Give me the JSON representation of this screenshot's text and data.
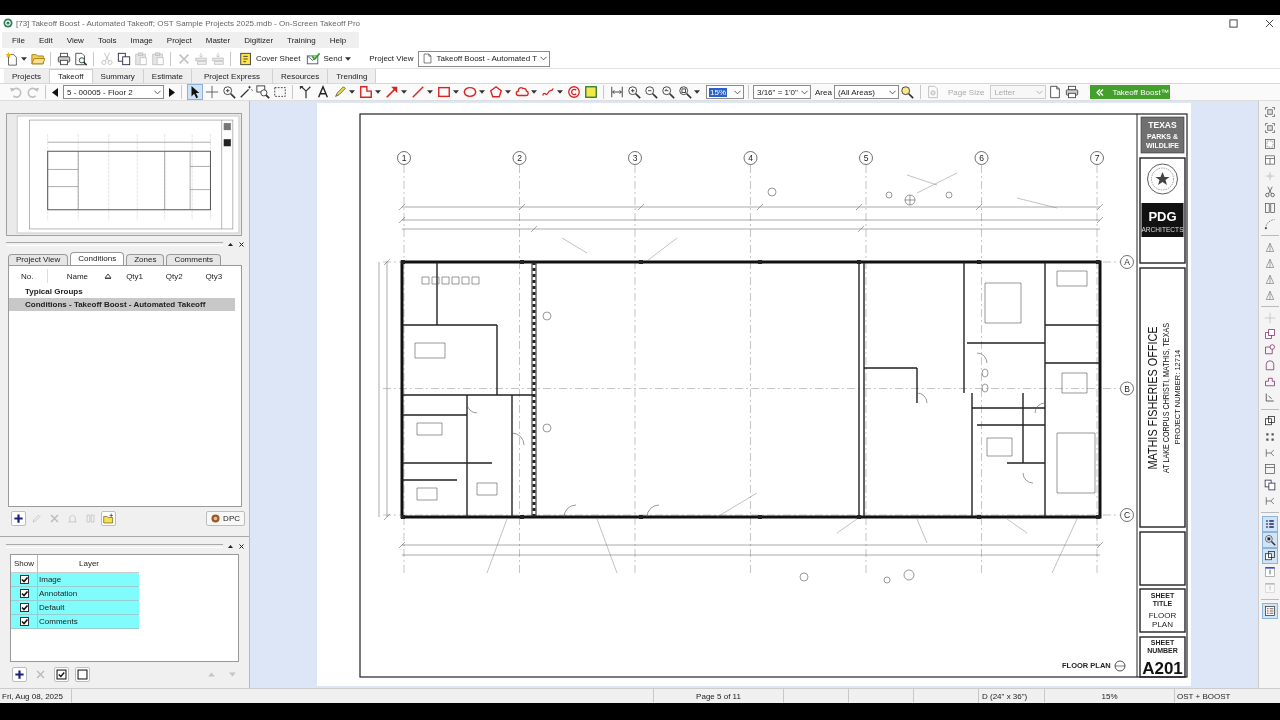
{
  "window": {
    "title": "[73] Takeoff Boost - Automated Takeoff; OST Sample Projects 2025.mdb - On-Screen Takeoff Pro"
  },
  "menu": [
    "File",
    "Edit",
    "View",
    "Tools",
    "Image",
    "Project",
    "Master",
    "Digitizer",
    "Training",
    "Help"
  ],
  "toolbar": {
    "groups": [
      [
        {
          "kind": "new",
          "disabled": false
        },
        {
          "kind": "dropdown",
          "disabled": false
        },
        {
          "kind": "open",
          "disabled": false
        }
      ],
      [
        {
          "kind": "print",
          "disabled": false
        },
        {
          "kind": "preview",
          "disabled": false
        }
      ],
      [
        {
          "kind": "cut",
          "disabled": true
        },
        {
          "kind": "copy",
          "disabled": false
        },
        {
          "kind": "paste",
          "disabled": true
        },
        {
          "kind": "paste",
          "disabled": true
        }
      ],
      [
        {
          "kind": "delete",
          "disabled": true
        },
        {
          "kind": "stack",
          "disabled": true
        },
        {
          "kind": "stack",
          "disabled": true
        }
      ]
    ],
    "cover_sheet": "Cover Sheet",
    "send": "Send",
    "project_view_label": "Project View",
    "project_view_select": "Takeoff Boost - Automated T"
  },
  "tabs": [
    {
      "label": "Projects",
      "selected": false
    },
    {
      "label": "Takeoff",
      "selected": true
    },
    {
      "label": "Summary",
      "selected": false
    },
    {
      "label": "Estimate",
      "selected": false
    },
    {
      "label": "Project Express",
      "selected": false
    },
    {
      "label": "Resources",
      "selected": false
    },
    {
      "label": "Trending",
      "selected": false
    }
  ],
  "page_toolbar": {
    "history": [
      {
        "kind": "undo",
        "disabled": true
      },
      {
        "kind": "redo",
        "disabled": true
      }
    ],
    "page_select": "5 - 00005 - Floor 2",
    "tools": [
      {
        "kind": "pointer",
        "selected": true
      },
      {
        "kind": "crosshair",
        "selected": false
      },
      {
        "kind": "zoom-box",
        "selected": false
      },
      {
        "kind": "wand",
        "selected": false
      },
      {
        "kind": "magnify",
        "selected": false
      },
      {
        "kind": "marquee",
        "selected": false
      }
    ],
    "markup": [
      {
        "kind": "measure"
      },
      {
        "kind": "text"
      },
      {
        "kind": "highlighter"
      },
      {
        "kind": "dropdown"
      },
      {
        "kind": "shape"
      },
      {
        "kind": "dropdown"
      },
      {
        "kind": "arrow"
      },
      {
        "kind": "dropdown"
      },
      {
        "kind": "line"
      },
      {
        "kind": "dropdown"
      },
      {
        "kind": "rect"
      },
      {
        "kind": "dropdown"
      },
      {
        "kind": "ellipse"
      },
      {
        "kind": "dropdown"
      },
      {
        "kind": "polygon"
      },
      {
        "kind": "dropdown"
      },
      {
        "kind": "cloud"
      },
      {
        "kind": "dropdown"
      },
      {
        "kind": "freehand"
      },
      {
        "kind": "dropdown"
      },
      {
        "kind": "stamp"
      },
      {
        "kind": "note"
      }
    ],
    "zoom_tools": [
      {
        "kind": "fit"
      },
      {
        "kind": "zoom-in"
      },
      {
        "kind": "zoom-out"
      },
      {
        "kind": "zoom-prev"
      },
      {
        "kind": "zoom-page"
      },
      {
        "kind": "dropdown"
      }
    ],
    "zoom": "15%",
    "zoom_focused": true,
    "scale": "3/16\" = 1'0\"",
    "area_label": "Area",
    "area_select": "(All Areas)",
    "page_size_label": "Page Size",
    "page_size_select": "Letter",
    "page_size_disabled": true,
    "boost_button": "Takeoff Boost™"
  },
  "conditions_panel": {
    "tabs": [
      {
        "label": "Project View",
        "selected": false
      },
      {
        "label": "Conditions",
        "selected": true
      },
      {
        "label": "Zones",
        "selected": false
      },
      {
        "label": "Comments",
        "selected": false
      }
    ],
    "columns": [
      "No.",
      "Name",
      "Qty1",
      "Qty2",
      "Qty3"
    ],
    "groups": [
      {
        "name": "Typical Groups",
        "selected": false
      },
      {
        "name": "Conditions - Takeoff Boost - Automated Takeoff",
        "selected": true
      }
    ],
    "buttons": [
      {
        "kind": "add",
        "disabled": false
      },
      {
        "kind": "edit",
        "disabled": true
      },
      {
        "kind": "delete",
        "disabled": true
      },
      {
        "kind": "style",
        "disabled": true
      },
      {
        "kind": "copy-style",
        "disabled": true
      },
      {
        "kind": "folder-new",
        "disabled": false
      }
    ],
    "dpc_button": "DPC"
  },
  "layers_panel": {
    "columns": [
      "Show",
      "Layer"
    ],
    "rows": [
      {
        "name": "Image",
        "checked": true
      },
      {
        "name": "Annotation",
        "checked": true
      },
      {
        "name": "Default",
        "checked": true
      },
      {
        "name": "Comments",
        "checked": true
      }
    ],
    "buttons": [
      {
        "kind": "add",
        "disabled": false
      },
      {
        "kind": "delete",
        "disabled": true
      },
      {
        "kind": "check-all",
        "disabled": false
      },
      {
        "kind": "uncheck-all",
        "disabled": false
      },
      {
        "kind": "move-up",
        "disabled": true
      },
      {
        "kind": "move-down",
        "disabled": true
      }
    ]
  },
  "sheet": {
    "grid_columns": [
      "1",
      "2",
      "3",
      "4",
      "5",
      "6",
      "7"
    ],
    "grid_rows": [
      "A",
      "B",
      "C"
    ],
    "plan_label": "FLOOR PLAN",
    "title_block": {
      "agency": [
        "TEXAS",
        "PARKS &",
        "WILDLIFE"
      ],
      "firm": "PDG",
      "firm_sub": "ARCHITECTS",
      "project": "MATHIS FISHERIES OFFICE",
      "location": "AT LAKE CORPUS CHRISTI, MATHIS, TEXAS",
      "project_number": "PROJECT NUMBER: 12714",
      "sheet_title_label": "SHEET TITLE",
      "sheet_title": "FLOOR PLAN",
      "sheet_number_label": "SHEET NUMBER",
      "sheet_number": "A201"
    }
  },
  "side_toolbar": {
    "groups": [
      [
        {
          "kind": "frame",
          "disabled": false,
          "selected": false
        },
        {
          "kind": "frame",
          "disabled": false,
          "selected": false
        },
        {
          "kind": "panel",
          "disabled": false,
          "selected": false
        },
        {
          "kind": "table",
          "disabled": false,
          "selected": false
        },
        {
          "kind": "sparkle",
          "disabled": true,
          "selected": false
        },
        {
          "kind": "cut",
          "disabled": false,
          "selected": false
        },
        {
          "kind": "columns",
          "disabled": false,
          "selected": false
        },
        {
          "kind": "curve",
          "disabled": false,
          "selected": false
        }
      ],
      [
        {
          "kind": "tri",
          "disabled": false,
          "selected": false
        },
        {
          "kind": "tri",
          "disabled": false,
          "selected": false
        },
        {
          "kind": "tri",
          "disabled": false,
          "selected": false
        },
        {
          "kind": "tri",
          "disabled": false,
          "selected": false
        }
      ],
      [
        {
          "kind": "crosshair",
          "disabled": true,
          "selected": false
        },
        {
          "kind": "shape-join",
          "disabled": false,
          "selected": false
        },
        {
          "kind": "shape-cut",
          "disabled": false,
          "selected": false
        },
        {
          "kind": "shape-arc",
          "disabled": false,
          "selected": false
        },
        {
          "kind": "shape-notch",
          "disabled": false,
          "selected": false
        },
        {
          "kind": "shape-corner",
          "disabled": false,
          "selected": false
        }
      ],
      [
        {
          "kind": "overlap",
          "disabled": false,
          "selected": false
        },
        {
          "kind": "dots",
          "disabled": false,
          "selected": false
        },
        {
          "kind": "branch",
          "disabled": false,
          "selected": false
        },
        {
          "kind": "ruler-box",
          "disabled": false,
          "selected": false
        },
        {
          "kind": "copy",
          "disabled": false,
          "selected": false
        },
        {
          "kind": "branch",
          "disabled": false,
          "selected": false
        }
      ],
      [
        {
          "kind": "list",
          "disabled": false,
          "selected": true
        },
        {
          "kind": "zoom-find",
          "disabled": false,
          "selected": true
        },
        {
          "kind": "overlap",
          "disabled": false,
          "selected": true
        },
        {
          "kind": "corner",
          "disabled": false,
          "selected": false
        },
        {
          "kind": "corner",
          "disabled": true,
          "selected": false
        }
      ],
      [
        {
          "kind": "legend",
          "disabled": false,
          "selected": true
        }
      ]
    ]
  },
  "status_bar": {
    "date": "Fri, Aug 08, 2025",
    "page": "Page 5 of 11",
    "sheet_size": "D (24\" x 36\")",
    "zoom": "15%",
    "mode": "OST + BOOST"
  }
}
